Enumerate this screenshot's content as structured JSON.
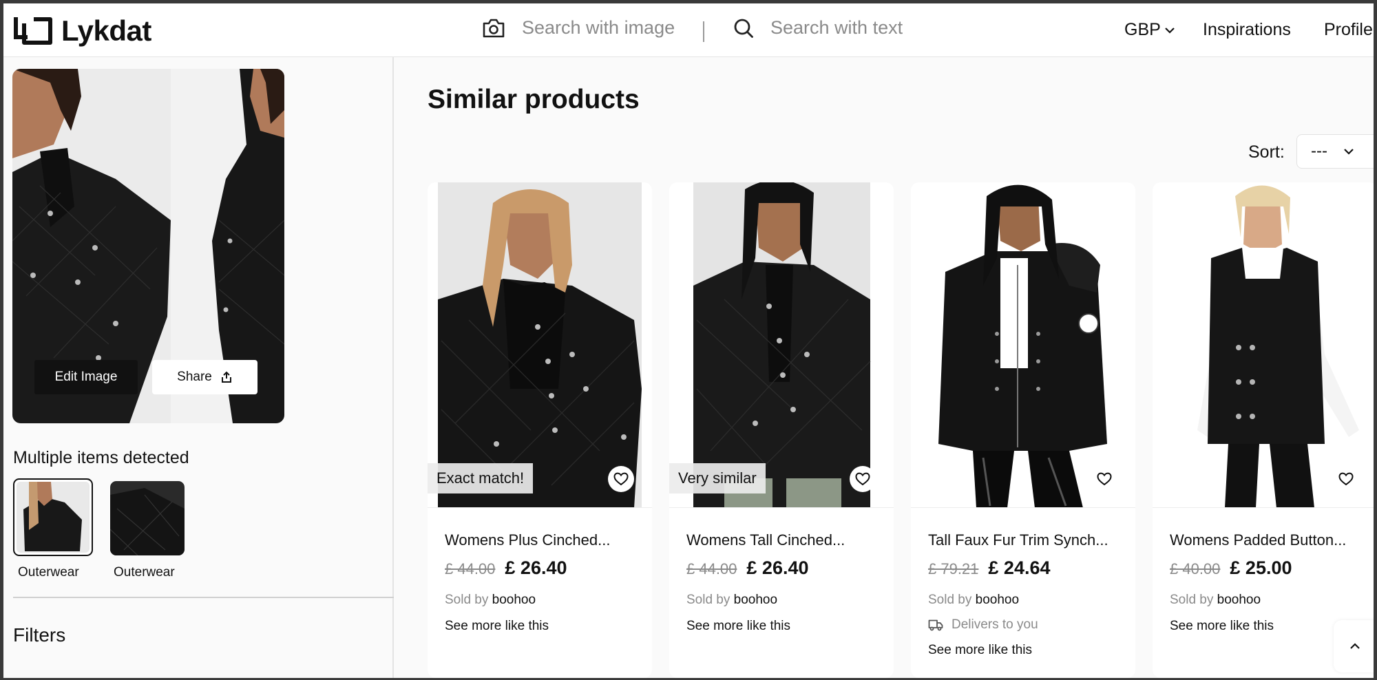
{
  "header": {
    "brand": "Lykdat",
    "search_image_placeholder": "Search with image",
    "search_text_placeholder": "Search with text",
    "currency": "GBP",
    "nav_inspirations": "Inspirations",
    "nav_profile": "Profile"
  },
  "query": {
    "edit_label": "Edit Image",
    "share_label": "Share",
    "multi_title": "Multiple items detected",
    "items": [
      {
        "label": "Outerwear",
        "selected": true
      },
      {
        "label": "Outerwear",
        "selected": false
      }
    ],
    "filters_title": "Filters"
  },
  "results": {
    "title": "Similar products",
    "sort_label": "Sort:",
    "sort_value": "---",
    "products": [
      {
        "badge": "Exact match!",
        "title": "Womens Plus Cinched...",
        "old_price": "£ 44.00",
        "price": "£ 26.40",
        "sold_by_label": "Sold by",
        "seller": "boohoo",
        "delivers": "",
        "more": "See more like this"
      },
      {
        "badge": "Very similar",
        "title": "Womens Tall Cinched...",
        "old_price": "£ 44.00",
        "price": "£ 26.40",
        "sold_by_label": "Sold by",
        "seller": "boohoo",
        "delivers": "",
        "more": "See more like this"
      },
      {
        "badge": "",
        "title": "Tall Faux Fur Trim Synch...",
        "old_price": "£ 79.21",
        "price": "£ 24.64",
        "sold_by_label": "Sold by",
        "seller": "boohoo",
        "delivers": "Delivers to you",
        "more": "See more like this"
      },
      {
        "badge": "",
        "title": "Womens Padded Button...",
        "old_price": "£ 40.00",
        "price": "£ 25.00",
        "sold_by_label": "Sold by",
        "seller": "boohoo",
        "delivers": "",
        "more": "See more like this"
      }
    ]
  },
  "icons": {
    "camera": "camera-icon",
    "search": "search-icon",
    "chevron": "chevron-down-icon",
    "share": "share-icon",
    "heart": "heart-icon",
    "truck": "truck-icon",
    "scroll_up": "chevron-up-icon"
  },
  "colors": {
    "text": "#111111",
    "muted": "#8a8a8a",
    "jacket": "#151515",
    "button_dark": "#111111"
  }
}
